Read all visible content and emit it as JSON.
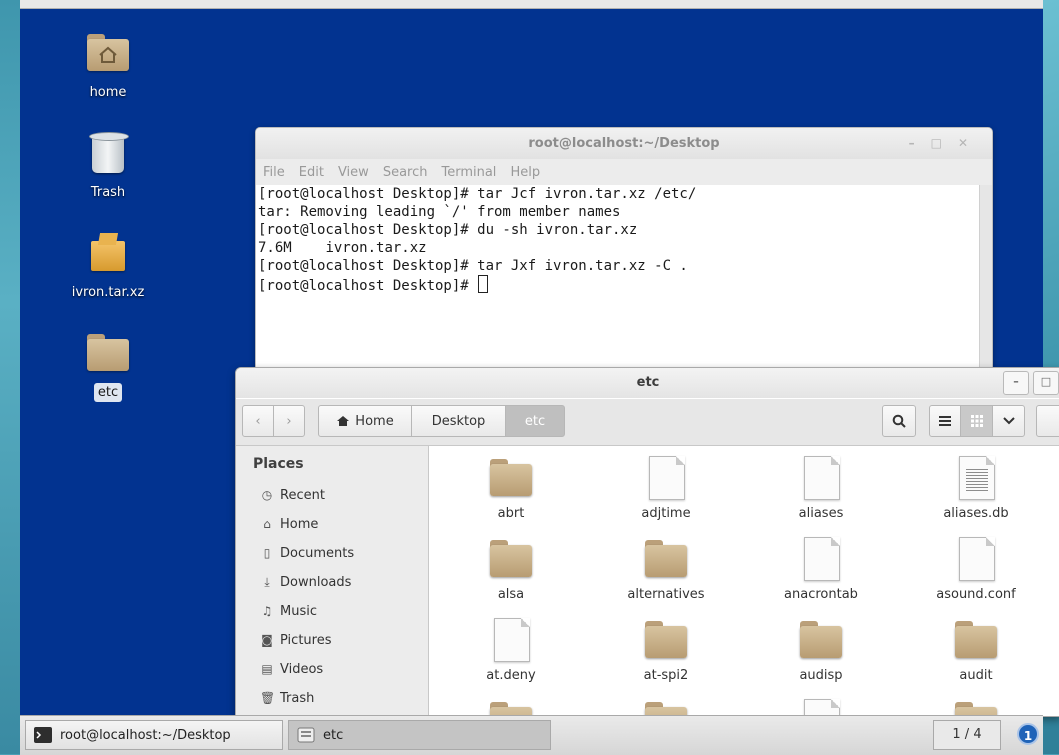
{
  "desktop": {
    "icons": [
      {
        "label": "home",
        "icon": "home-folder-icon"
      },
      {
        "label": "Trash",
        "icon": "trash-icon"
      },
      {
        "label": "ivron.tar.xz",
        "icon": "archive-icon"
      },
      {
        "label": "etc",
        "icon": "folder-icon",
        "selected": true
      }
    ]
  },
  "terminal": {
    "title": "root@localhost:~/Desktop",
    "menu": [
      "File",
      "Edit",
      "View",
      "Search",
      "Terminal",
      "Help"
    ],
    "lines": [
      "[root@localhost Desktop]# tar Jcf ivron.tar.xz /etc/",
      "tar: Removing leading `/' from member names",
      "[root@localhost Desktop]# du -sh ivron.tar.xz",
      "7.6M\tivron.tar.xz",
      "[root@localhost Desktop]# tar Jxf ivron.tar.xz -C .",
      "[root@localhost Desktop]# "
    ]
  },
  "files": {
    "title": "etc",
    "breadcrumbs": [
      "Home",
      "Desktop",
      "etc"
    ],
    "sidebar": {
      "heading": "Places",
      "items": [
        {
          "label": "Recent",
          "icon": "clock-icon"
        },
        {
          "label": "Home",
          "icon": "home-icon"
        },
        {
          "label": "Documents",
          "icon": "document-icon"
        },
        {
          "label": "Downloads",
          "icon": "download-icon"
        },
        {
          "label": "Music",
          "icon": "music-icon"
        },
        {
          "label": "Pictures",
          "icon": "camera-icon"
        },
        {
          "label": "Videos",
          "icon": "film-icon"
        },
        {
          "label": "Trash",
          "icon": "trash-icon"
        }
      ]
    },
    "items": [
      {
        "name": "abrt",
        "type": "folder"
      },
      {
        "name": "adjtime",
        "type": "file"
      },
      {
        "name": "aliases",
        "type": "file"
      },
      {
        "name": "aliases.db",
        "type": "text"
      },
      {
        "name": "alsa",
        "type": "folder"
      },
      {
        "name": "alternatives",
        "type": "folder"
      },
      {
        "name": "anacrontab",
        "type": "file"
      },
      {
        "name": "asound.conf",
        "type": "file"
      },
      {
        "name": "at.deny",
        "type": "file"
      },
      {
        "name": "at-spi2",
        "type": "folder"
      },
      {
        "name": "audisp",
        "type": "folder"
      },
      {
        "name": "audit",
        "type": "folder"
      }
    ]
  },
  "taskbar": {
    "tasks": [
      {
        "label": "root@localhost:~/Desktop",
        "icon": "terminal-icon"
      },
      {
        "label": "etc",
        "icon": "file-manager-icon"
      }
    ],
    "pager": "1 / 4",
    "notification_count": "1"
  }
}
